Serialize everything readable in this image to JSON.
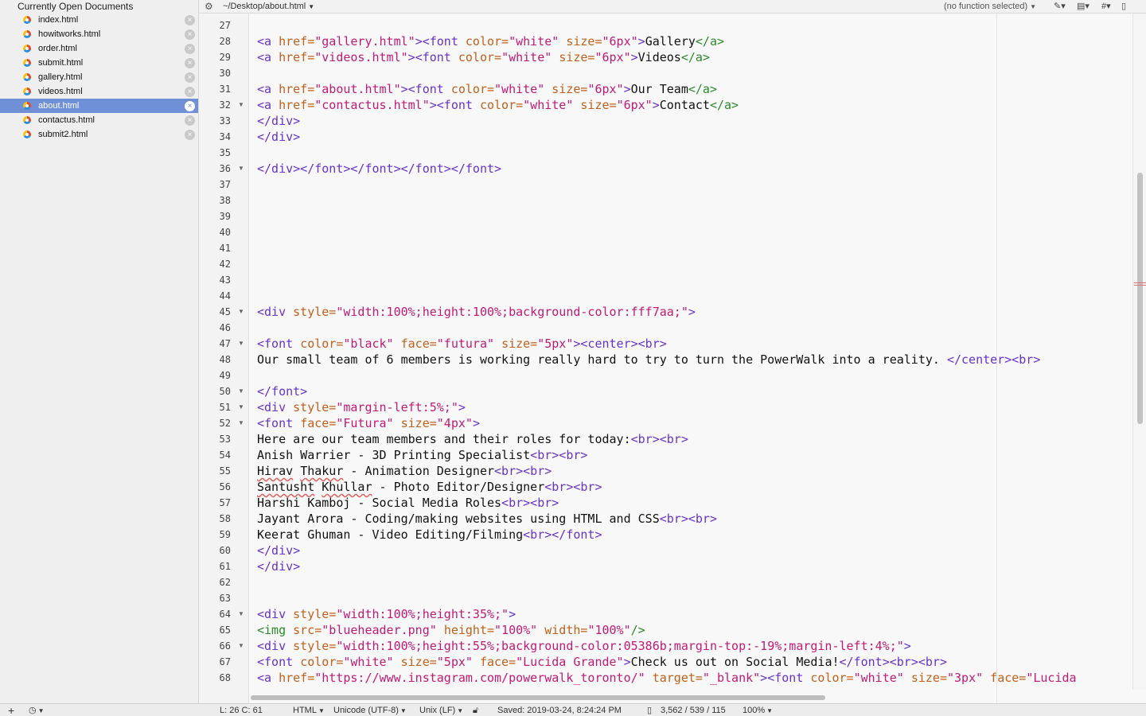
{
  "sidebar": {
    "title": "Currently Open Documents",
    "documents": [
      {
        "name": "index.html",
        "active": false
      },
      {
        "name": "howitworks.html",
        "active": false
      },
      {
        "name": "order.html",
        "active": false
      },
      {
        "name": "submit.html",
        "active": false
      },
      {
        "name": "gallery.html",
        "active": false
      },
      {
        "name": "videos.html",
        "active": false
      },
      {
        "name": "about.html",
        "active": true
      },
      {
        "name": "contactus.html",
        "active": false
      },
      {
        "name": "submit2.html",
        "active": false
      }
    ],
    "close_glyph": "×"
  },
  "topbar": {
    "path": "~/Desktop/about.html",
    "function_selector": "(no function selected)"
  },
  "editor": {
    "lines": [
      {
        "n": 27,
        "fold": false,
        "tokens": []
      },
      {
        "n": 28,
        "fold": false,
        "tokens": [
          [
            "t",
            "<a "
          ],
          [
            "at",
            "href="
          ],
          [
            "v",
            "\"gallery.html\""
          ],
          [
            "t",
            ">"
          ],
          [
            "t",
            "<font "
          ],
          [
            "at",
            "color="
          ],
          [
            "v",
            "\"white\" "
          ],
          [
            "at",
            "size="
          ],
          [
            "v",
            "\"6px\""
          ],
          [
            "t",
            ">"
          ],
          [
            "tx",
            "Gallery"
          ],
          [
            "tg",
            "</a>"
          ]
        ]
      },
      {
        "n": 29,
        "fold": false,
        "tokens": [
          [
            "t",
            "<a "
          ],
          [
            "at",
            "href="
          ],
          [
            "v",
            "\"videos.html\""
          ],
          [
            "t",
            ">"
          ],
          [
            "t",
            "<font "
          ],
          [
            "at",
            "color="
          ],
          [
            "v",
            "\"white\" "
          ],
          [
            "at",
            "size="
          ],
          [
            "v",
            "\"6px\""
          ],
          [
            "t",
            ">"
          ],
          [
            "tx",
            "Videos"
          ],
          [
            "tg",
            "</a>"
          ]
        ]
      },
      {
        "n": 30,
        "fold": false,
        "tokens": []
      },
      {
        "n": 31,
        "fold": false,
        "tokens": [
          [
            "t",
            "<a "
          ],
          [
            "at",
            "href="
          ],
          [
            "v",
            "\"about.html\""
          ],
          [
            "t",
            ">"
          ],
          [
            "t",
            "<font "
          ],
          [
            "at",
            "color="
          ],
          [
            "v",
            "\"white\" "
          ],
          [
            "at",
            "size="
          ],
          [
            "v",
            "\"6px\""
          ],
          [
            "t",
            ">"
          ],
          [
            "tx",
            "Our Team"
          ],
          [
            "tg",
            "</a>"
          ]
        ]
      },
      {
        "n": 32,
        "fold": true,
        "tokens": [
          [
            "t",
            "<a "
          ],
          [
            "at",
            "href="
          ],
          [
            "v",
            "\"contactus.html\""
          ],
          [
            "t",
            ">"
          ],
          [
            "t",
            "<font "
          ],
          [
            "at",
            "color="
          ],
          [
            "v",
            "\"white\" "
          ],
          [
            "at",
            "size="
          ],
          [
            "v",
            "\"6px\""
          ],
          [
            "t",
            ">"
          ],
          [
            "tx",
            "Contact"
          ],
          [
            "tg",
            "</a>"
          ]
        ]
      },
      {
        "n": 33,
        "fold": false,
        "tokens": [
          [
            "t",
            "</div>"
          ]
        ]
      },
      {
        "n": 34,
        "fold": false,
        "tokens": [
          [
            "t",
            "</div>"
          ]
        ]
      },
      {
        "n": 35,
        "fold": false,
        "tokens": []
      },
      {
        "n": 36,
        "fold": true,
        "tokens": [
          [
            "t",
            "</div></font></font></font></font>"
          ]
        ]
      },
      {
        "n": 37,
        "fold": false,
        "tokens": []
      },
      {
        "n": 38,
        "fold": false,
        "tokens": []
      },
      {
        "n": 39,
        "fold": false,
        "tokens": []
      },
      {
        "n": 40,
        "fold": false,
        "tokens": []
      },
      {
        "n": 41,
        "fold": false,
        "tokens": []
      },
      {
        "n": 42,
        "fold": false,
        "tokens": []
      },
      {
        "n": 43,
        "fold": false,
        "tokens": []
      },
      {
        "n": 44,
        "fold": false,
        "tokens": []
      },
      {
        "n": 45,
        "fold": true,
        "tokens": [
          [
            "t",
            "<div "
          ],
          [
            "at",
            "style="
          ],
          [
            "v",
            "\"width:100%;height:100%;background-color:fff7aa;\""
          ],
          [
            "t",
            ">"
          ]
        ]
      },
      {
        "n": 46,
        "fold": false,
        "tokens": []
      },
      {
        "n": 47,
        "fold": true,
        "tokens": [
          [
            "t",
            "<font "
          ],
          [
            "at",
            "color="
          ],
          [
            "v",
            "\"black\" "
          ],
          [
            "at",
            "face="
          ],
          [
            "v",
            "\"futura\" "
          ],
          [
            "at",
            "size="
          ],
          [
            "v",
            "\"5px\""
          ],
          [
            "t",
            ">"
          ],
          [
            "t",
            "<center><br>"
          ]
        ]
      },
      {
        "n": 48,
        "fold": false,
        "tokens": [
          [
            "tx",
            "Our small team of 6 members is working really hard to try to turn the PowerWalk into a reality. "
          ],
          [
            "t",
            "</center><br>"
          ]
        ]
      },
      {
        "n": 49,
        "fold": false,
        "tokens": []
      },
      {
        "n": 50,
        "fold": true,
        "tokens": [
          [
            "t",
            "</font>"
          ]
        ]
      },
      {
        "n": 51,
        "fold": true,
        "tokens": [
          [
            "t",
            "<div "
          ],
          [
            "at",
            "style="
          ],
          [
            "v",
            "\"margin-left:5%;\""
          ],
          [
            "t",
            ">"
          ]
        ]
      },
      {
        "n": 52,
        "fold": true,
        "tokens": [
          [
            "t",
            "<font "
          ],
          [
            "at",
            "face="
          ],
          [
            "v",
            "\"Futura\" "
          ],
          [
            "at",
            "size="
          ],
          [
            "v",
            "\"4px\""
          ],
          [
            "t",
            ">"
          ]
        ]
      },
      {
        "n": 53,
        "fold": false,
        "tokens": [
          [
            "tx",
            "Here are our team members and their roles for today:"
          ],
          [
            "t",
            "<br><br>"
          ]
        ]
      },
      {
        "n": 54,
        "fold": false,
        "tokens": [
          [
            "tx",
            "Anish Warrier - 3D Printing Specialist"
          ],
          [
            "t",
            "<br><br>"
          ]
        ]
      },
      {
        "n": 55,
        "fold": false,
        "tokens": [
          [
            "sp",
            "Hirav"
          ],
          [
            "tx",
            " "
          ],
          [
            "sp",
            "Thakur"
          ],
          [
            "tx",
            " - Animation Designer"
          ],
          [
            "t",
            "<br><br>"
          ]
        ]
      },
      {
        "n": 56,
        "fold": false,
        "tokens": [
          [
            "sp",
            "Santusht"
          ],
          [
            "tx",
            " "
          ],
          [
            "sp",
            "Khullar"
          ],
          [
            "tx",
            " - Photo Editor/Designer"
          ],
          [
            "t",
            "<br><br>"
          ]
        ]
      },
      {
        "n": 57,
        "fold": false,
        "tokens": [
          [
            "tx",
            "Harshi Kamboj - Social Media Roles"
          ],
          [
            "t",
            "<br><br>"
          ]
        ]
      },
      {
        "n": 58,
        "fold": false,
        "tokens": [
          [
            "tx",
            "Jayant Arora - Coding/making websites using HTML and CSS"
          ],
          [
            "t",
            "<br><br>"
          ]
        ]
      },
      {
        "n": 59,
        "fold": false,
        "tokens": [
          [
            "tx",
            "Keerat Ghuman - Video Editing/Filming"
          ],
          [
            "t",
            "<br></font>"
          ]
        ]
      },
      {
        "n": 60,
        "fold": false,
        "tokens": [
          [
            "t",
            "</div>"
          ]
        ]
      },
      {
        "n": 61,
        "fold": false,
        "tokens": [
          [
            "t",
            "</div>"
          ]
        ]
      },
      {
        "n": 62,
        "fold": false,
        "tokens": []
      },
      {
        "n": 63,
        "fold": false,
        "tokens": []
      },
      {
        "n": 64,
        "fold": true,
        "tokens": [
          [
            "t",
            "<div "
          ],
          [
            "at",
            "style="
          ],
          [
            "v",
            "\"width:100%;height:35%;\""
          ],
          [
            "t",
            ">"
          ]
        ]
      },
      {
        "n": 65,
        "fold": false,
        "tokens": [
          [
            "tg",
            "<img "
          ],
          [
            "at",
            "src="
          ],
          [
            "v",
            "\"blueheader.png\" "
          ],
          [
            "at",
            "height="
          ],
          [
            "v",
            "\"100%\" "
          ],
          [
            "at",
            "width="
          ],
          [
            "v",
            "\"100%\""
          ],
          [
            "tg",
            "/>"
          ]
        ]
      },
      {
        "n": 66,
        "fold": true,
        "tokens": [
          [
            "t",
            "<div "
          ],
          [
            "at",
            "style="
          ],
          [
            "v",
            "\"width:100%;height:55%;background-color:05386b;margin-top:-19%;margin-left:4%;\""
          ],
          [
            "t",
            ">"
          ]
        ]
      },
      {
        "n": 67,
        "fold": false,
        "tokens": [
          [
            "t",
            "<font "
          ],
          [
            "at",
            "color="
          ],
          [
            "v",
            "\"white\" "
          ],
          [
            "at",
            "size="
          ],
          [
            "v",
            "\"5px\" "
          ],
          [
            "at",
            "face="
          ],
          [
            "v",
            "\"Lucida Grande\""
          ],
          [
            "t",
            ">"
          ],
          [
            "tx",
            "Check us out on Social Media!"
          ],
          [
            "t",
            "</font><br><br>"
          ]
        ]
      },
      {
        "n": 68,
        "fold": false,
        "tokens": [
          [
            "t",
            "<a "
          ],
          [
            "at",
            "href="
          ],
          [
            "v",
            "\"https://www.instagram.com/powerwalk_toronto/\" "
          ],
          [
            "at",
            "target="
          ],
          [
            "v",
            "\"_blank\""
          ],
          [
            "t",
            ">"
          ],
          [
            "t",
            "<font "
          ],
          [
            "at",
            "color="
          ],
          [
            "v",
            "\"white\" "
          ],
          [
            "at",
            "size="
          ],
          [
            "v",
            "\"3px\" "
          ],
          [
            "at",
            "face="
          ],
          [
            "v",
            "\"Lucida"
          ]
        ]
      }
    ]
  },
  "statusbar": {
    "position": "L: 26 C: 61",
    "language": "HTML",
    "encoding": "Unicode (UTF-8)",
    "line_endings": "Unix (LF)",
    "saved": "Saved: 2019-03-24, 8:24:24 PM",
    "stats": "3,562 / 539 / 115",
    "zoom": "100%"
  },
  "colors": {
    "tag": "#6633cc",
    "attribute": "#c0601a",
    "value": "#c21a74",
    "selection": "#6f8fd6"
  },
  "icons": [
    "gear-icon",
    "file-icon",
    "close-icon",
    "fold-icon",
    "pen-icon",
    "stack-icon",
    "hash-icon",
    "document-icon",
    "plus-icon",
    "clock-icon",
    "lock-icon"
  ]
}
